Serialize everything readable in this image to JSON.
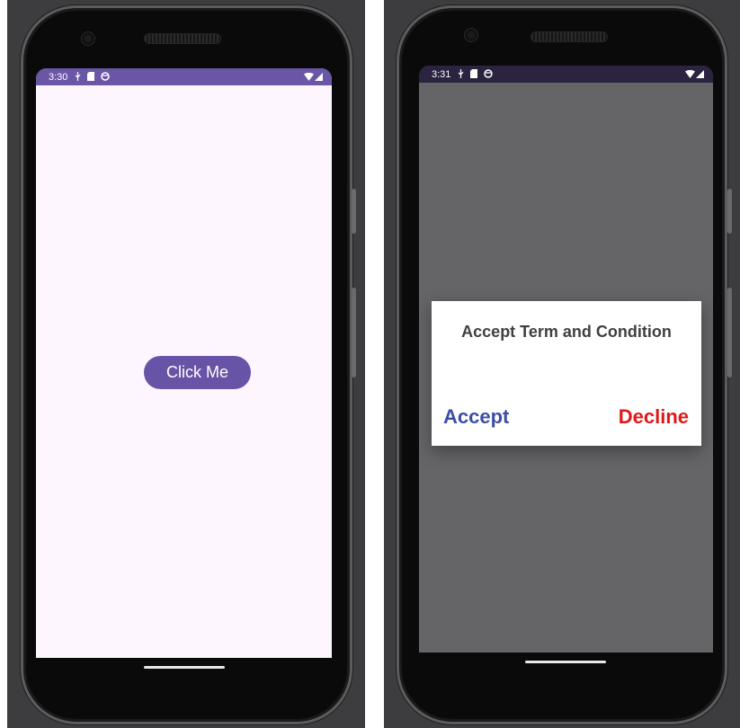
{
  "left_phone": {
    "status_bar": {
      "time": "3:30",
      "icons": [
        "usb-icon",
        "sd-card-icon",
        "face-icon"
      ],
      "right_icons": [
        "wifi-icon",
        "signal-icon"
      ]
    },
    "main_button_label": "Click Me"
  },
  "right_phone": {
    "status_bar": {
      "time": "3:31",
      "icons": [
        "usb-icon",
        "sd-card-icon",
        "face-icon"
      ],
      "right_icons": [
        "wifi-icon",
        "signal-icon"
      ]
    },
    "dialog": {
      "title": "Accept Term and Condition",
      "positive_label": "Accept",
      "negative_label": "Decline"
    }
  },
  "colors": {
    "primary": "#6a56a6",
    "status_bar_dimmed": "#2b2340",
    "screen_background": "#fdf6fe",
    "scrim": "#656467",
    "accept_text": "#3b4fa5",
    "decline_text": "#e0181a"
  }
}
